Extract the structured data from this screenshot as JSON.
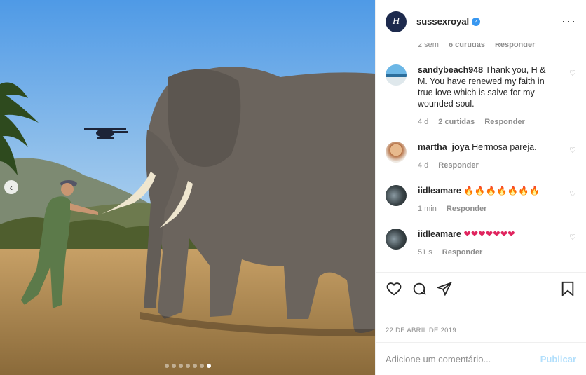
{
  "post": {
    "username": "sussexroyal",
    "verified": true,
    "more_icon": "more-horizontal-icon",
    "brand_initial": "H",
    "date": "22 DE ABRIL DE 2019"
  },
  "photo": {
    "carousel_dots": 7,
    "active_dot": 7
  },
  "partial_meta": {
    "time": "2 sem",
    "likes": "6 curtidas",
    "reply": "Responder"
  },
  "comments": [
    {
      "user": "sandybeach948",
      "text": "Thank you, H & M. You have renewed my faith in true love which is salve for my wounded soul.",
      "time": "4 d",
      "likes": "2 curtidas",
      "reply": "Responder"
    },
    {
      "user": "martha_joya",
      "text": "Hermosa pareja.",
      "time": "4 d",
      "likes": "",
      "reply": "Responder"
    },
    {
      "user": "iidleamare",
      "text": "🔥🔥🔥🔥🔥🔥🔥",
      "time": "1 min",
      "likes": "",
      "reply": "Responder"
    },
    {
      "user": "iidleamare",
      "text": "❤❤❤❤❤❤❤",
      "time": "51 s",
      "likes": "",
      "reply": "Responder"
    }
  ],
  "add_comment": {
    "placeholder": "Adicione um comentário...",
    "publish": "Publicar"
  },
  "colors": {
    "link_disabled": "#b2dffc",
    "verified": "#3897f0",
    "muted": "#8e8e8e"
  }
}
